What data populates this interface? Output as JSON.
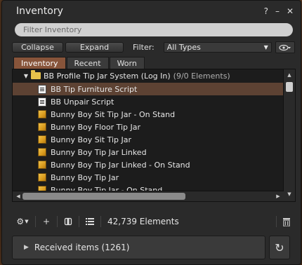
{
  "window": {
    "title": "Inventory",
    "help_icon": "?",
    "minimize_icon": "–",
    "close_icon": "✕"
  },
  "search": {
    "placeholder": "Filter Inventory",
    "value": ""
  },
  "toolbar": {
    "collapse_label": "Collapse",
    "expand_label": "Expand",
    "filter_label": "Filter:",
    "filter_value": "All Types",
    "eye_icon": "eye-icon"
  },
  "tabs": [
    {
      "label": "Inventory",
      "active": true
    },
    {
      "label": "Recent",
      "active": false
    },
    {
      "label": "Worn",
      "active": false
    }
  ],
  "tree": {
    "folder": {
      "name": "BB Profile Tip Jar System (Log In)",
      "suffix": "(9/0 Elements)"
    },
    "items": [
      {
        "label": "BB Tip Furniture Script",
        "icon": "script-icon",
        "selected": true
      },
      {
        "label": "BB Unpair Script",
        "icon": "script-icon",
        "selected": false
      },
      {
        "label": "Bunny Boy Sit Tip Jar - On Stand",
        "icon": "object-icon",
        "selected": false
      },
      {
        "label": "Bunny Boy Floor Tip Jar",
        "icon": "object-icon",
        "selected": false
      },
      {
        "label": "Bunny Boy Sit Tip Jar",
        "icon": "object-icon",
        "selected": false
      },
      {
        "label": "Bunny Boy Tip Jar Linked",
        "icon": "object-icon",
        "selected": false
      },
      {
        "label": "Bunny Boy Tip Jar Linked - On Stand",
        "icon": "object-icon",
        "selected": false
      },
      {
        "label": "Bunny Boy Tip Jar",
        "icon": "object-icon",
        "selected": false
      },
      {
        "label": "Bunny Boy Tip Jar - On Stand",
        "icon": "object-icon",
        "selected": false
      }
    ]
  },
  "status": {
    "elements": "42,739 Elements"
  },
  "received": {
    "label": "Received items (1261)"
  },
  "colors": {
    "active_tab": "#87543a",
    "selected_row": "#5d4233",
    "folder": "#e8c24b"
  }
}
